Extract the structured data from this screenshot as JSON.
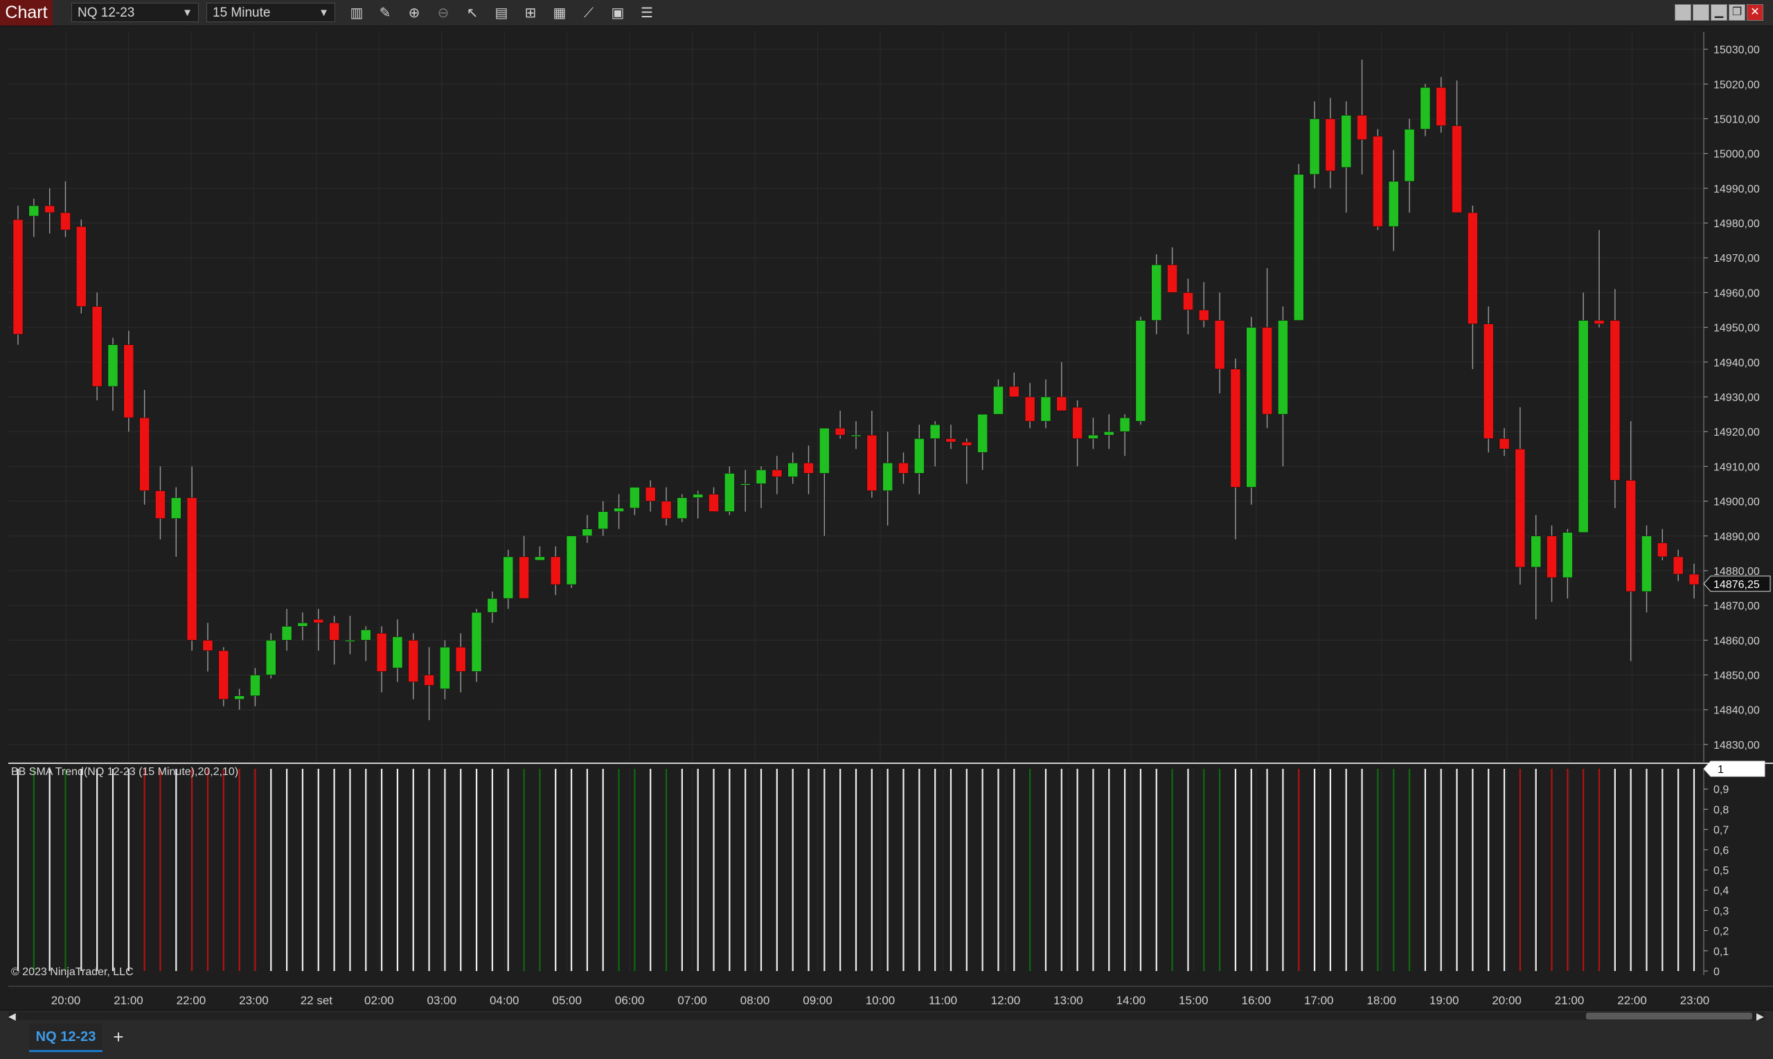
{
  "window": {
    "title": "Chart"
  },
  "toolbar": {
    "instrument": "NQ 12-23",
    "interval": "15 Minute",
    "tools": [
      "bar-type-icon",
      "draw-tool-icon",
      "zoom-in-icon",
      "zoom-out-icon",
      "pointer-icon",
      "data-box-icon",
      "properties-icon",
      "strategies-icon",
      "indicators-icon",
      "templates-icon",
      "list-icon"
    ]
  },
  "colors": {
    "background": "#1e1e1e",
    "up": "#21c021",
    "down": "#ee1111",
    "grid": "#2c2c2c",
    "indicator_white": "#f0f0f0",
    "indicator_green": "#0d6b0d",
    "indicator_red": "#b31212"
  },
  "indicator": {
    "label": "BB SMA Trend(NQ 12-23 (15 Minute),20,2,10)",
    "current_value": "1"
  },
  "copyright": "© 2023 NinjaTrader, LLC",
  "tabs": [
    {
      "label": "NQ 12-23"
    }
  ],
  "chart_data": {
    "type": "candlestick",
    "title": "",
    "last_price_label": "14876,25",
    "y_ticks": [
      "15030,00",
      "15020,00",
      "15010,00",
      "15000,00",
      "14990,00",
      "14980,00",
      "14970,00",
      "14960,00",
      "14950,00",
      "14940,00",
      "14930,00",
      "14920,00",
      "14910,00",
      "14900,00",
      "14890,00",
      "14880,00",
      "14870,00",
      "14860,00",
      "14850,00",
      "14840,00",
      "14830,00"
    ],
    "ylim": [
      14825,
      15035
    ],
    "x_ticks": [
      "20:00",
      "21:00",
      "22:00",
      "23:00",
      "22 set",
      "02:00",
      "03:00",
      "04:00",
      "05:00",
      "06:00",
      "07:00",
      "08:00",
      "09:00",
      "10:00",
      "11:00",
      "12:00",
      "13:00",
      "14:00",
      "15:00",
      "16:00",
      "17:00",
      "18:00",
      "19:00",
      "20:00",
      "21:00",
      "22:00",
      "23:00"
    ],
    "candles": [
      [
        14981,
        14985,
        14945,
        14948
      ],
      [
        14982,
        14987,
        14976,
        14985
      ],
      [
        14985,
        14990,
        14977,
        14983
      ],
      [
        14983,
        14992,
        14976,
        14978
      ],
      [
        14979,
        14981,
        14954,
        14956
      ],
      [
        14956,
        14960,
        14929,
        14933
      ],
      [
        14933,
        14947,
        14926,
        14945
      ],
      [
        14945,
        14949,
        14920,
        14924
      ],
      [
        14924,
        14932,
        14899,
        14903
      ],
      [
        14903,
        14910,
        14889,
        14895
      ],
      [
        14895,
        14904,
        14884,
        14901
      ],
      [
        14901,
        14910,
        14857,
        14860
      ],
      [
        14860,
        14865,
        14851,
        14857
      ],
      [
        14857,
        14858,
        14841,
        14843
      ],
      [
        14843,
        14846,
        14840,
        14844
      ],
      [
        14844,
        14852,
        14841,
        14850
      ],
      [
        14850,
        14862,
        14849,
        14860
      ],
      [
        14860,
        14869,
        14857,
        14864
      ],
      [
        14864,
        14868,
        14860,
        14865
      ],
      [
        14866,
        14869,
        14857,
        14865
      ],
      [
        14865,
        14867,
        14853,
        14860
      ],
      [
        14860,
        14867,
        14856,
        14860
      ],
      [
        14860,
        14864,
        14854,
        14863
      ],
      [
        14862,
        14864,
        14845,
        14851
      ],
      [
        14852,
        14866,
        14848,
        14861
      ],
      [
        14860,
        14862,
        14843,
        14848
      ],
      [
        14850,
        14858,
        14837,
        14847
      ],
      [
        14846,
        14860,
        14843,
        14858
      ],
      [
        14858,
        14862,
        14845,
        14851
      ],
      [
        14851,
        14869,
        14848,
        14868
      ],
      [
        14868,
        14874,
        14865,
        14872
      ],
      [
        14872,
        14886,
        14869,
        14884
      ],
      [
        14884,
        14890,
        14872,
        14872
      ],
      [
        14883,
        14887,
        14883,
        14884
      ],
      [
        14884,
        14887,
        14873,
        14876
      ],
      [
        14876,
        14890,
        14875,
        14890
      ],
      [
        14890,
        14896,
        14888,
        14892
      ],
      [
        14892,
        14900,
        14890,
        14897
      ],
      [
        14897,
        14902,
        14892,
        14898
      ],
      [
        14898,
        14904,
        14896,
        14904
      ],
      [
        14904,
        14906,
        14897,
        14900
      ],
      [
        14900,
        14904,
        14893,
        14895
      ],
      [
        14895,
        14902,
        14894,
        14901
      ],
      [
        14901,
        14903,
        14895,
        14902
      ],
      [
        14902,
        14904,
        14897,
        14897
      ],
      [
        14897,
        14910,
        14896,
        14908
      ],
      [
        14905,
        14909,
        14897,
        14905
      ],
      [
        14905,
        14910,
        14898,
        14909
      ],
      [
        14909,
        14913,
        14902,
        14907
      ],
      [
        14907,
        14914,
        14905,
        14911
      ],
      [
        14911,
        14916,
        14902,
        14908
      ],
      [
        14908,
        14920,
        14890,
        14921
      ],
      [
        14921,
        14926,
        14918,
        14919
      ],
      [
        14919,
        14923,
        14915,
        14919
      ],
      [
        14919,
        14926,
        14901,
        14903
      ],
      [
        14903,
        14920,
        14893,
        14911
      ],
      [
        14911,
        14914,
        14905,
        14908
      ],
      [
        14908,
        14922,
        14902,
        14918
      ],
      [
        14918,
        14923,
        14910,
        14922
      ],
      [
        14918,
        14922,
        14915,
        14917
      ],
      [
        14917,
        14918,
        14905,
        14916
      ],
      [
        14914,
        14921,
        14909,
        14925
      ],
      [
        14925,
        14935,
        14925,
        14933
      ],
      [
        14933,
        14937,
        14930,
        14930
      ],
      [
        14930,
        14934,
        14921,
        14923
      ],
      [
        14923,
        14935,
        14921,
        14930
      ],
      [
        14930,
        14940,
        14928,
        14926
      ],
      [
        14927,
        14929,
        14910,
        14918
      ],
      [
        14918,
        14924,
        14915,
        14919
      ],
      [
        14919,
        14925,
        14915,
        14920
      ],
      [
        14920,
        14925,
        14913,
        14924
      ],
      [
        14923,
        14953,
        14922,
        14952
      ],
      [
        14952,
        14971,
        14948,
        14968
      ],
      [
        14968,
        14973,
        14960,
        14960
      ],
      [
        14960,
        14964,
        14948,
        14955
      ],
      [
        14955,
        14963,
        14950,
        14952
      ],
      [
        14952,
        14960,
        14931,
        14938
      ],
      [
        14938,
        14941,
        14889,
        14904
      ],
      [
        14904,
        14953,
        14899,
        14950
      ],
      [
        14950,
        14967,
        14921,
        14925
      ],
      [
        14925,
        14956,
        14910,
        14952
      ],
      [
        14952,
        14997,
        14952,
        14994
      ],
      [
        14994,
        15015,
        14990,
        15010
      ],
      [
        15010,
        15016,
        14990,
        14995
      ],
      [
        14996,
        15015,
        14983,
        15011
      ],
      [
        15011,
        15027,
        14994,
        15004
      ],
      [
        15005,
        15007,
        14978,
        14979
      ],
      [
        14979,
        15001,
        14972,
        14992
      ],
      [
        14992,
        15010,
        14983,
        15007
      ],
      [
        15007,
        15020,
        15005,
        15019
      ],
      [
        15019,
        15022,
        15006,
        15008
      ],
      [
        15008,
        15021,
        14983,
        14983
      ],
      [
        14983,
        14985,
        14938,
        14951
      ],
      [
        14951,
        14956,
        14914,
        14918
      ],
      [
        14918,
        14921,
        14913,
        14915
      ],
      [
        14915,
        14927,
        14876,
        14881
      ],
      [
        14881,
        14896,
        14866,
        14890
      ],
      [
        14890,
        14893,
        14871,
        14878
      ],
      [
        14878,
        14892,
        14872,
        14891
      ],
      [
        14891,
        14960,
        14891,
        14952
      ],
      [
        14952,
        14978,
        14950,
        14951
      ],
      [
        14952,
        14961,
        14898,
        14906
      ],
      [
        14906,
        14923,
        14854,
        14874
      ],
      [
        14874,
        14893,
        14868,
        14890
      ],
      [
        14888,
        14892,
        14883,
        14884
      ],
      [
        14884,
        14886,
        14877,
        14879
      ],
      [
        14879,
        14882,
        14872,
        14876
      ]
    ],
    "trend": [
      1,
      2,
      1,
      2,
      1,
      1,
      1,
      1,
      3,
      3,
      1,
      3,
      3,
      3,
      3,
      3,
      1,
      1,
      1,
      1,
      1,
      1,
      1,
      1,
      1,
      1,
      1,
      1,
      1,
      1,
      1,
      1,
      2,
      2,
      1,
      1,
      1,
      1,
      2,
      2,
      1,
      2,
      1,
      1,
      1,
      1,
      1,
      1,
      1,
      1,
      1,
      1,
      1,
      1,
      1,
      1,
      1,
      1,
      1,
      1,
      1,
      1,
      1,
      1,
      2,
      1,
      1,
      1,
      1,
      1,
      1,
      1,
      1,
      2,
      1,
      2,
      2,
      1,
      1,
      1,
      1,
      3,
      1,
      1,
      1,
      1,
      2,
      2,
      2,
      1,
      1,
      1,
      1,
      1,
      1,
      3,
      1,
      3,
      3,
      3,
      3,
      1,
      1,
      1,
      1,
      1,
      1
    ],
    "indicator_y_ticks": [
      "1",
      "0,9",
      "0,8",
      "0,7",
      "0,6",
      "0,5",
      "0,4",
      "0,3",
      "0,2",
      "0,1",
      "0"
    ]
  }
}
